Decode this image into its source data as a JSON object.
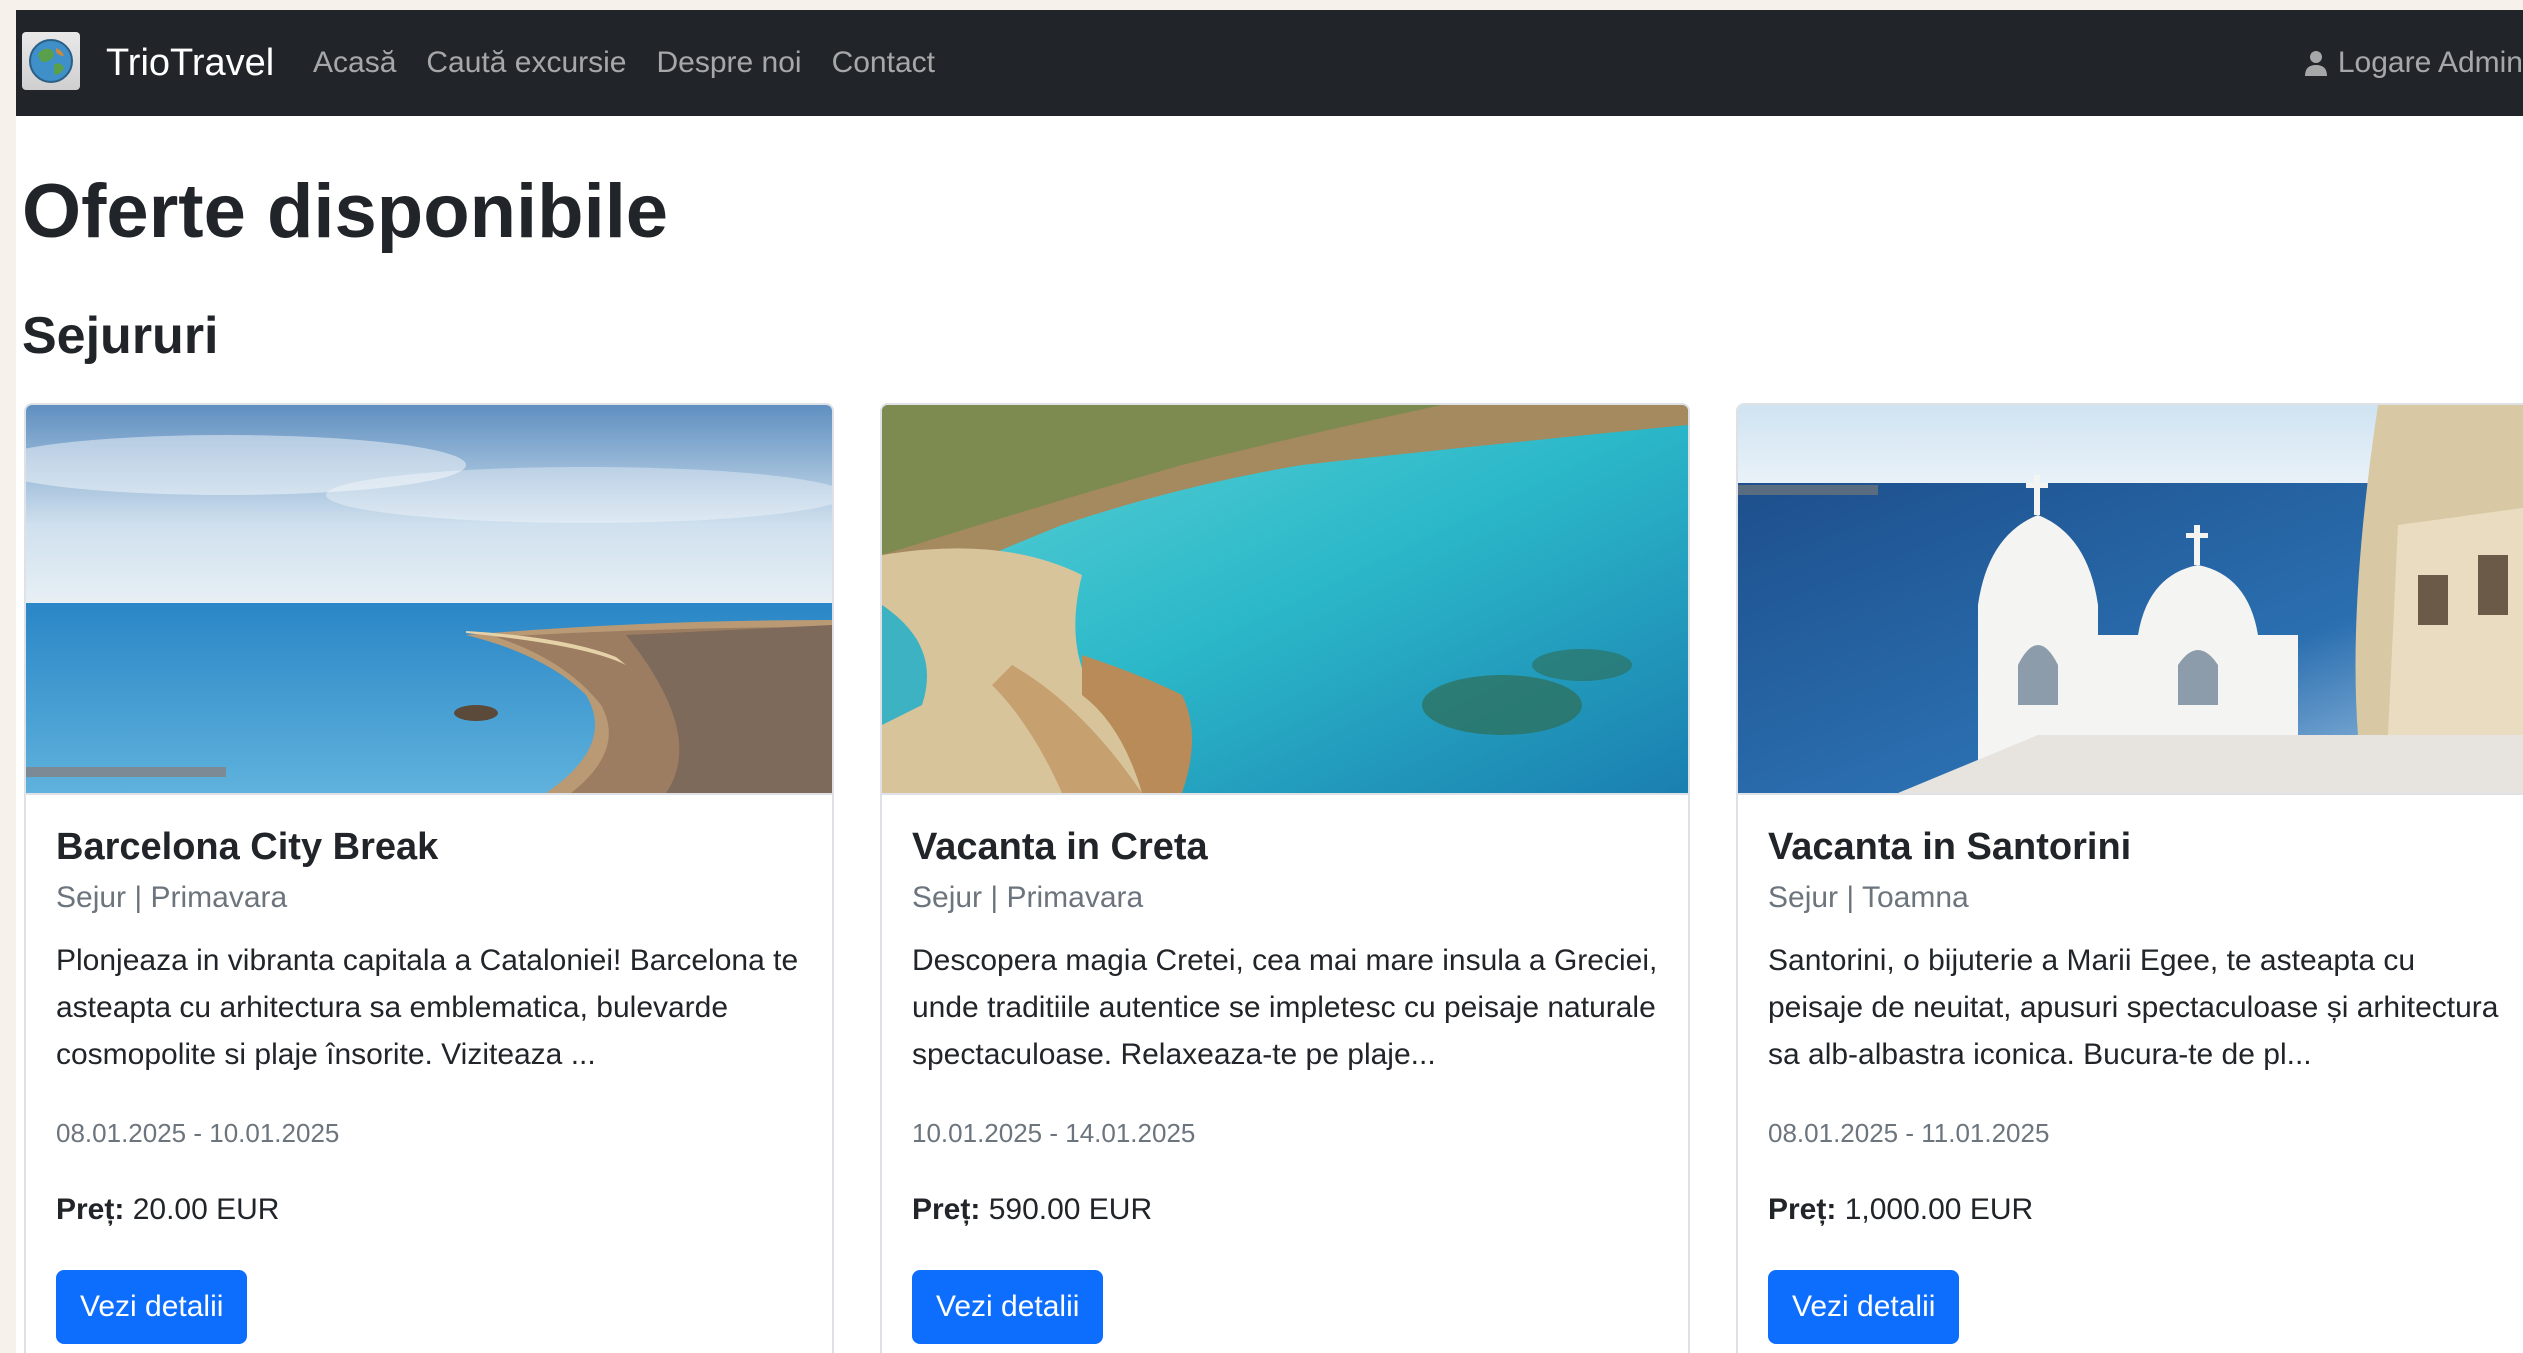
{
  "navbar": {
    "brand": "TrioTravel",
    "links": [
      "Acasă",
      "Caută excursie",
      "Despre noi",
      "Contact"
    ],
    "login_label": "Logare Admin"
  },
  "page": {
    "title": "Oferte disponibile",
    "section_title": "Sejururi"
  },
  "cards": [
    {
      "title": "Barcelona City Break",
      "subtitle": "Sejur | Primavara",
      "description": "Plonjeaza in vibranta capitala a Cataloniei! Barcelona te asteapta cu arhitectura sa emblematica, bulevarde cosmopolite si plaje însorite. Viziteaza ...",
      "dates": "08.01.2025 - 10.01.2025",
      "price_label": "Preț:",
      "price": "20.00 EUR",
      "button": "Vezi detalii"
    },
    {
      "title": "Vacanta in Creta",
      "subtitle": "Sejur | Primavara",
      "description": "Descopera magia Cretei, cea mai mare insula a Greciei, unde traditiile autentice se impletesc cu peisaje naturale spectaculoase. Relaxeaza-te pe plaje...",
      "dates": "10.01.2025 - 14.01.2025",
      "price_label": "Preț:",
      "price": "590.00 EUR",
      "button": "Vezi detalii"
    },
    {
      "title": "Vacanta in Santorini",
      "subtitle": "Sejur | Toamna",
      "description": "Santorini, o bijuterie a Marii Egee, te asteapta cu peisaje de neuitat, apusuri spectaculoase și arhitectura sa alb-albastra iconica. Bucura-te de pl...",
      "dates": "08.01.2025 - 11.01.2025",
      "price_label": "Preț:",
      "price": "1,000.00 EUR",
      "button": "Vezi detalii"
    }
  ],
  "colors": {
    "navbar_bg": "#212529",
    "primary": "#0d6efd",
    "muted": "#6c757d"
  }
}
